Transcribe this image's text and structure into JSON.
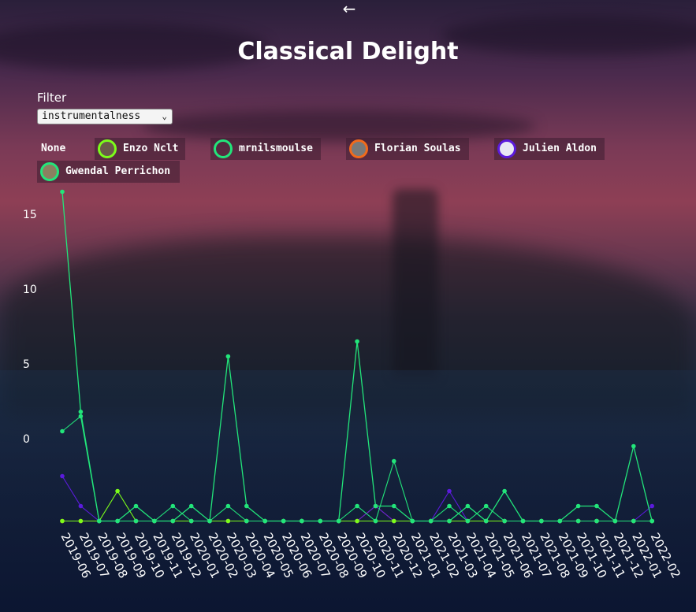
{
  "title": "Classical Delight",
  "filter": {
    "label": "Filter",
    "selected": "instrumentalness"
  },
  "legend": {
    "none_label": "None",
    "items": [
      {
        "name": "Enzo Nclt",
        "color": "#7cfc1a"
      },
      {
        "name": "mrnilsmoulse",
        "color": "#22e57a"
      },
      {
        "name": "Florian Soulas",
        "color": "#f26a1b"
      },
      {
        "name": "Julien Aldon",
        "color": "#5b1bdc"
      },
      {
        "name": "Gwendal Perrichon",
        "color": "#22e57a"
      }
    ]
  },
  "chart_data": {
    "type": "line",
    "y_ticks": [
      0,
      5,
      10,
      15
    ],
    "categories": [
      "2019-06",
      "2019-07",
      "2019-08",
      "2019-09",
      "2019-10",
      "2019-11",
      "2019-12",
      "2020-01",
      "2020-02",
      "2020-03",
      "2020-04",
      "2020-05",
      "2020-06",
      "2020-07",
      "2020-08",
      "2020-09",
      "2020-10",
      "2020-11",
      "2020-12",
      "2021-01",
      "2021-02",
      "2021-03",
      "2021-04",
      "2021-05",
      "2021-06",
      "2021-07",
      "2021-08",
      "2021-09",
      "2021-10",
      "2021-11",
      "2021-12",
      "2022-01",
      "2022-02"
    ],
    "series": [
      {
        "color": "#22e57a",
        "width": 1.3,
        "values": [
          16.5,
          1.8,
          -5.5,
          -5.5,
          -4.5,
          -5.5,
          -5.5,
          -4.5,
          -5.5,
          5.5,
          -4.5,
          -5.5,
          -5.5,
          -5.5,
          -5.5,
          -5.5,
          6.5,
          -4.5,
          -4.5,
          -5.5,
          -5.5,
          -5.5,
          -4.5,
          -5.5,
          -3.5,
          -5.5,
          -5.5,
          -5.5,
          -4.5,
          -4.5,
          -5.5,
          -0.5,
          -5.5
        ]
      },
      {
        "color": "#22e57a",
        "width": 1.1,
        "values": [
          0.5,
          1.5,
          -5.5,
          -5.5,
          -5.5,
          -5.5,
          -4.5,
          -5.5,
          -5.5,
          -4.5,
          -5.5,
          -5.5,
          -5.5,
          -5.5,
          -5.5,
          -5.5,
          -4.5,
          -5.5,
          -1.5,
          -5.5,
          -5.5,
          -4.5,
          -5.5,
          -4.5,
          -5.5,
          -5.5,
          -5.5,
          -5.5,
          -5.5,
          -5.5,
          -5.5,
          -5.5,
          -5.5
        ]
      },
      {
        "color": "#7cfc1a",
        "width": 1.1,
        "values": [
          -5.5,
          -5.5,
          -5.5,
          -3.5,
          -5.5,
          -5.5,
          -5.5,
          -5.5,
          -5.5,
          -5.5,
          -5.5,
          -5.5,
          -5.5,
          -5.5,
          -5.5,
          -5.5,
          -5.5,
          -5.5,
          -5.5,
          -5.5,
          -5.5,
          -5.5,
          -5.5,
          -5.5,
          -5.5,
          -5.5,
          -5.5,
          -5.5,
          -5.5,
          -5.5,
          -5.5,
          -5.5,
          -5.5
        ]
      },
      {
        "color": "#5b1bdc",
        "width": 1.1,
        "values": [
          -2.5,
          -4.5,
          -5.5,
          -5.5,
          -5.5,
          -5.5,
          -5.5,
          -5.5,
          -5.5,
          -5.5,
          -5.5,
          -5.5,
          -5.5,
          -5.5,
          -5.5,
          -5.5,
          -5.5,
          -4.5,
          -5.5,
          -5.5,
          -5.5,
          -3.5,
          -5.5,
          -5.5,
          -5.5,
          -5.5,
          -5.5,
          -5.5,
          -5.5,
          -5.5,
          -5.5,
          -5.5,
          -4.5
        ]
      },
      {
        "color": "#f26a1b",
        "width": 1.1,
        "values": [
          -5.5,
          -5.5,
          -5.5,
          -5.5,
          -5.5,
          -5.5,
          -5.5,
          -5.5,
          -5.5,
          -5.5,
          -5.5,
          -5.5,
          -5.5,
          -5.5,
          -5.5,
          -5.5,
          -5.5,
          -4.5,
          -5.5,
          -5.5,
          -5.5,
          -5.5,
          -5.5,
          -5.5,
          -5.5,
          -5.5,
          -5.5,
          -5.5,
          -5.5,
          -5.5,
          -5.5,
          -5.5,
          -5.5
        ]
      }
    ]
  }
}
